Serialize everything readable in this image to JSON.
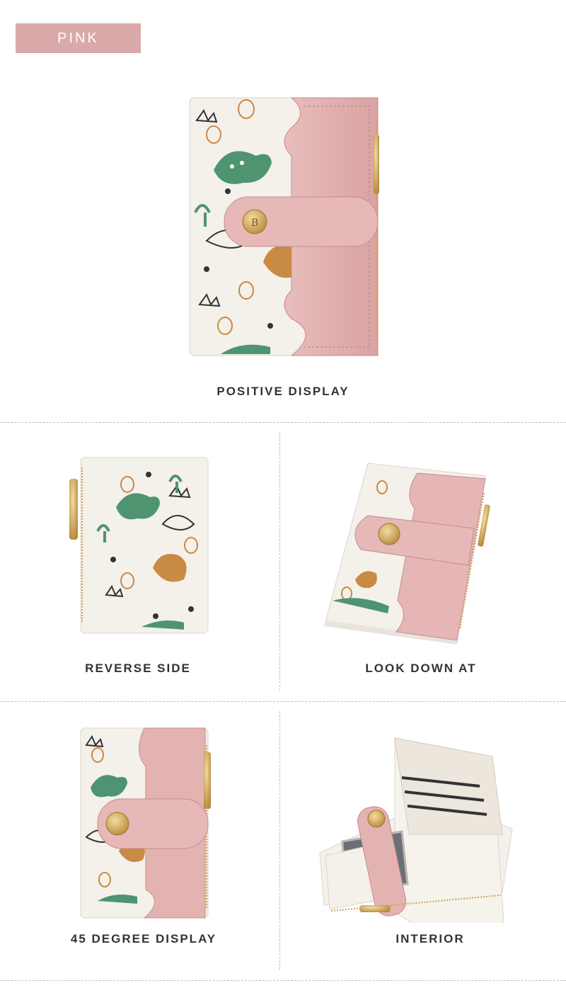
{
  "color_badge": "PINK",
  "views": [
    {
      "caption": "POSITIVE DISPLAY"
    },
    {
      "caption": "REVERSE SIDE"
    },
    {
      "caption": "LOOK DOWN AT"
    },
    {
      "caption": "45 DEGREE DISPLAY"
    },
    {
      "caption": "INTERIOR"
    }
  ],
  "colors": {
    "badge": "#d9aaa9",
    "wallet_pink": "#e3b3b2",
    "wallet_cream": "#f4f0ea",
    "print_green": "#4e9471",
    "print_orange": "#c98a44",
    "clasp_gold": "#c9a35a"
  }
}
